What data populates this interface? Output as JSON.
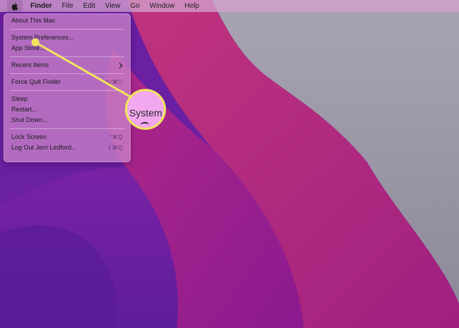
{
  "menubar": {
    "apple_icon": "apple-logo-icon",
    "items": [
      "Finder",
      "File",
      "Edit",
      "View",
      "Go",
      "Window",
      "Help"
    ]
  },
  "apple_menu": {
    "about": "About This Mac",
    "system_preferences": "System Preferences...",
    "app_store": "App Store...",
    "recent_items": "Recent Items",
    "recent_items_icon": "chevron-right-icon",
    "force_quit": "Force Quit Finder",
    "force_quit_shortcut": "⌥⌘⎋",
    "sleep": "Sleep",
    "restart": "Restart...",
    "shut_down": "Shut Down...",
    "lock_screen": "Lock Screen",
    "lock_screen_shortcut": "^⌘Q",
    "log_out": "Log Out Jerri Ledford...",
    "log_out_shortcut": "⇧⌘Q"
  },
  "callout": {
    "magnified_text": "System",
    "color": "#f1e45a"
  },
  "wallpaper_colors": {
    "base": "#6a1fa0",
    "magenta": "#c0307a",
    "gray": "#9a9aa8"
  }
}
